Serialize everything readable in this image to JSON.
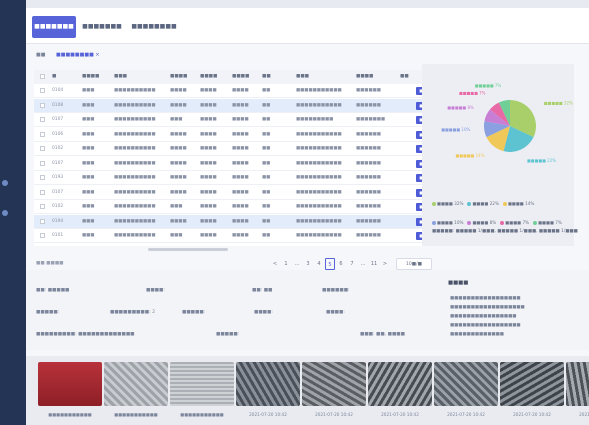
{
  "tabs": [
    {
      "label": "■■■■■■■",
      "active": true
    },
    {
      "label": "■■■■■■■",
      "active": false
    },
    {
      "label": "■■■■■■■■",
      "active": false
    }
  ],
  "crumbs": {
    "home": "■■",
    "tag": "■■■■■■■■ ×"
  },
  "table": {
    "headers": [
      "■",
      "■■■■",
      "■■■",
      "■■■■",
      "■■■■",
      "■■■■",
      "■■",
      "■■■",
      "■■■■",
      "■■"
    ],
    "rows": [
      [
        "0104",
        "■■■",
        "■■■■■■■■■■",
        "■■■■",
        "■■■■",
        "■■■■",
        "■■",
        "■■■■■■■■■■■",
        "■■■■■■",
        "■■"
      ],
      [
        "0108",
        "■■■",
        "■■■■■■■■■■",
        "■■■■",
        "■■■■",
        "■■■■",
        "■■",
        "■■■■■■■■■■■",
        "■■■■■■",
        "■■"
      ],
      [
        "0107",
        "■■■",
        "■■■■■■■■■■",
        "■■■",
        "■■■■",
        "■■■■",
        "■■",
        "■■■■■■■■■",
        "■■■■■■■",
        "■■"
      ],
      [
        "0106",
        "■■■",
        "■■■■■■■■■■",
        "■■■■",
        "■■■■",
        "■■■■",
        "■■",
        "■■■■■■■■■■■",
        "■■■■■■",
        "■■"
      ],
      [
        "0102",
        "■■■",
        "■■■■■■■■■■",
        "■■■■",
        "■■■■",
        "■■■■",
        "■■",
        "■■■■■■■■■■■",
        "■■■■■■",
        "■■"
      ],
      [
        "0107",
        "■■■",
        "■■■■■■■■■■",
        "■■■■",
        "■■■■",
        "■■■■",
        "■■",
        "■■■■■■■■■■■",
        "■■■■■■",
        "■■"
      ],
      [
        "0193",
        "■■■",
        "■■■■■■■■■■",
        "■■■■",
        "■■■■",
        "■■■■",
        "■■",
        "■■■■■■■■■■■",
        "■■■■■■",
        "■■"
      ],
      [
        "0107",
        "■■■",
        "■■■■■■■■■■",
        "■■■■",
        "■■■■",
        "■■■■",
        "■■",
        "■■■■■■■■■■■",
        "■■■■■■",
        "■■"
      ],
      [
        "0102",
        "■■■",
        "■■■■■■■■■■",
        "■■■",
        "■■■■",
        "■■■■",
        "■■",
        "■■■■■■■■■■■",
        "■■■■■■",
        "■■"
      ],
      [
        "0194",
        "■■■",
        "■■■■■■■■■■",
        "■■■■",
        "■■■■",
        "■■■■",
        "■■",
        "■■■■■■■■■■■",
        "■■■■■■",
        "■■"
      ],
      [
        "0101",
        "■■■",
        "■■■■■■■■■■",
        "■■■",
        "■■■■",
        "■■■■",
        "■■",
        "■■■■■■■■■■■",
        "■■■■■■",
        "■■"
      ]
    ],
    "selected_rows": [
      1,
      9
    ]
  },
  "pager": {
    "total": "■■ ■■■■",
    "items": [
      "<",
      "1",
      "...",
      "3",
      "4",
      "5",
      "6",
      "7",
      "...",
      "11",
      ">"
    ],
    "current": "5",
    "size": "10■/■"
  },
  "chart_data": {
    "type": "pie",
    "categories": [
      "■■■",
      "■■■",
      "■■■",
      "■■■",
      "■■■",
      "■■■",
      "■■■"
    ],
    "values": [
      32,
      22,
      14,
      10,
      8,
      7,
      7
    ],
    "colors": [
      "#a8cf6a",
      "#5ec3d1",
      "#f0c85a",
      "#8aa0e0",
      "#c77fd6",
      "#e76aa7",
      "#6fcf97"
    ],
    "slice_labels": [
      "■■■■■ 32%",
      "■■■■■ 22%",
      "■■■■■ 14%",
      "■■■■■ 10%",
      "■■■■■ 8%",
      "■■■■■ 7%",
      "■■■■■ 7%"
    ],
    "legend_text": [
      "■■■■ 32%",
      "■■■■ 22%",
      "■■■■ 14%",
      "■■■■ 10%",
      "■■■■ 8%",
      "■■■■ 7%",
      "■■■■ 7%"
    ]
  },
  "chart_note": "■■■■■: ■■■■■ 1/■■■, ■■■■■ 1/■■■, ■■■■■ 1/■■■",
  "detail": {
    "row1": [
      "■■: ■■■■■",
      "■■■■: ",
      "■■: ■■",
      "■■■■■■: "
    ],
    "row2": [
      "■■■■■: ",
      "■■■■■■■■■: 2",
      "■■■■■: ",
      "■■■■: ",
      "■■■■: "
    ],
    "row3": [
      "■■■■■■■■■: ■■■■■■■■■■■■■",
      "■■■■■: ",
      "■■■: ■■, ■■■■"
    ]
  },
  "side": {
    "title": "■■■■",
    "lines": [
      "■■■■■■■■■■■■■■■■■",
      "■■■■■■■■■■■■■■■■■■",
      "■■■■■■■■■■■■■■■■",
      "■■■■■■■■■■■■■■■■■",
      "■■■■■■■■■■■■■"
    ]
  },
  "gallery": {
    "captions": [
      "■■■■■■■■■■■",
      "■■■■■■■■■■■",
      "■■■■■■■■■■■",
      "2021-07-20 10:42",
      "2021-07-20 10:42",
      "2021-07-20 10:42",
      "2021-07-20 10:42",
      "2021-07-20 10:42",
      "2021-07-20 10:42"
    ]
  },
  "colors": {
    "accent": "#5763d8",
    "sidebar": "#233454"
  }
}
